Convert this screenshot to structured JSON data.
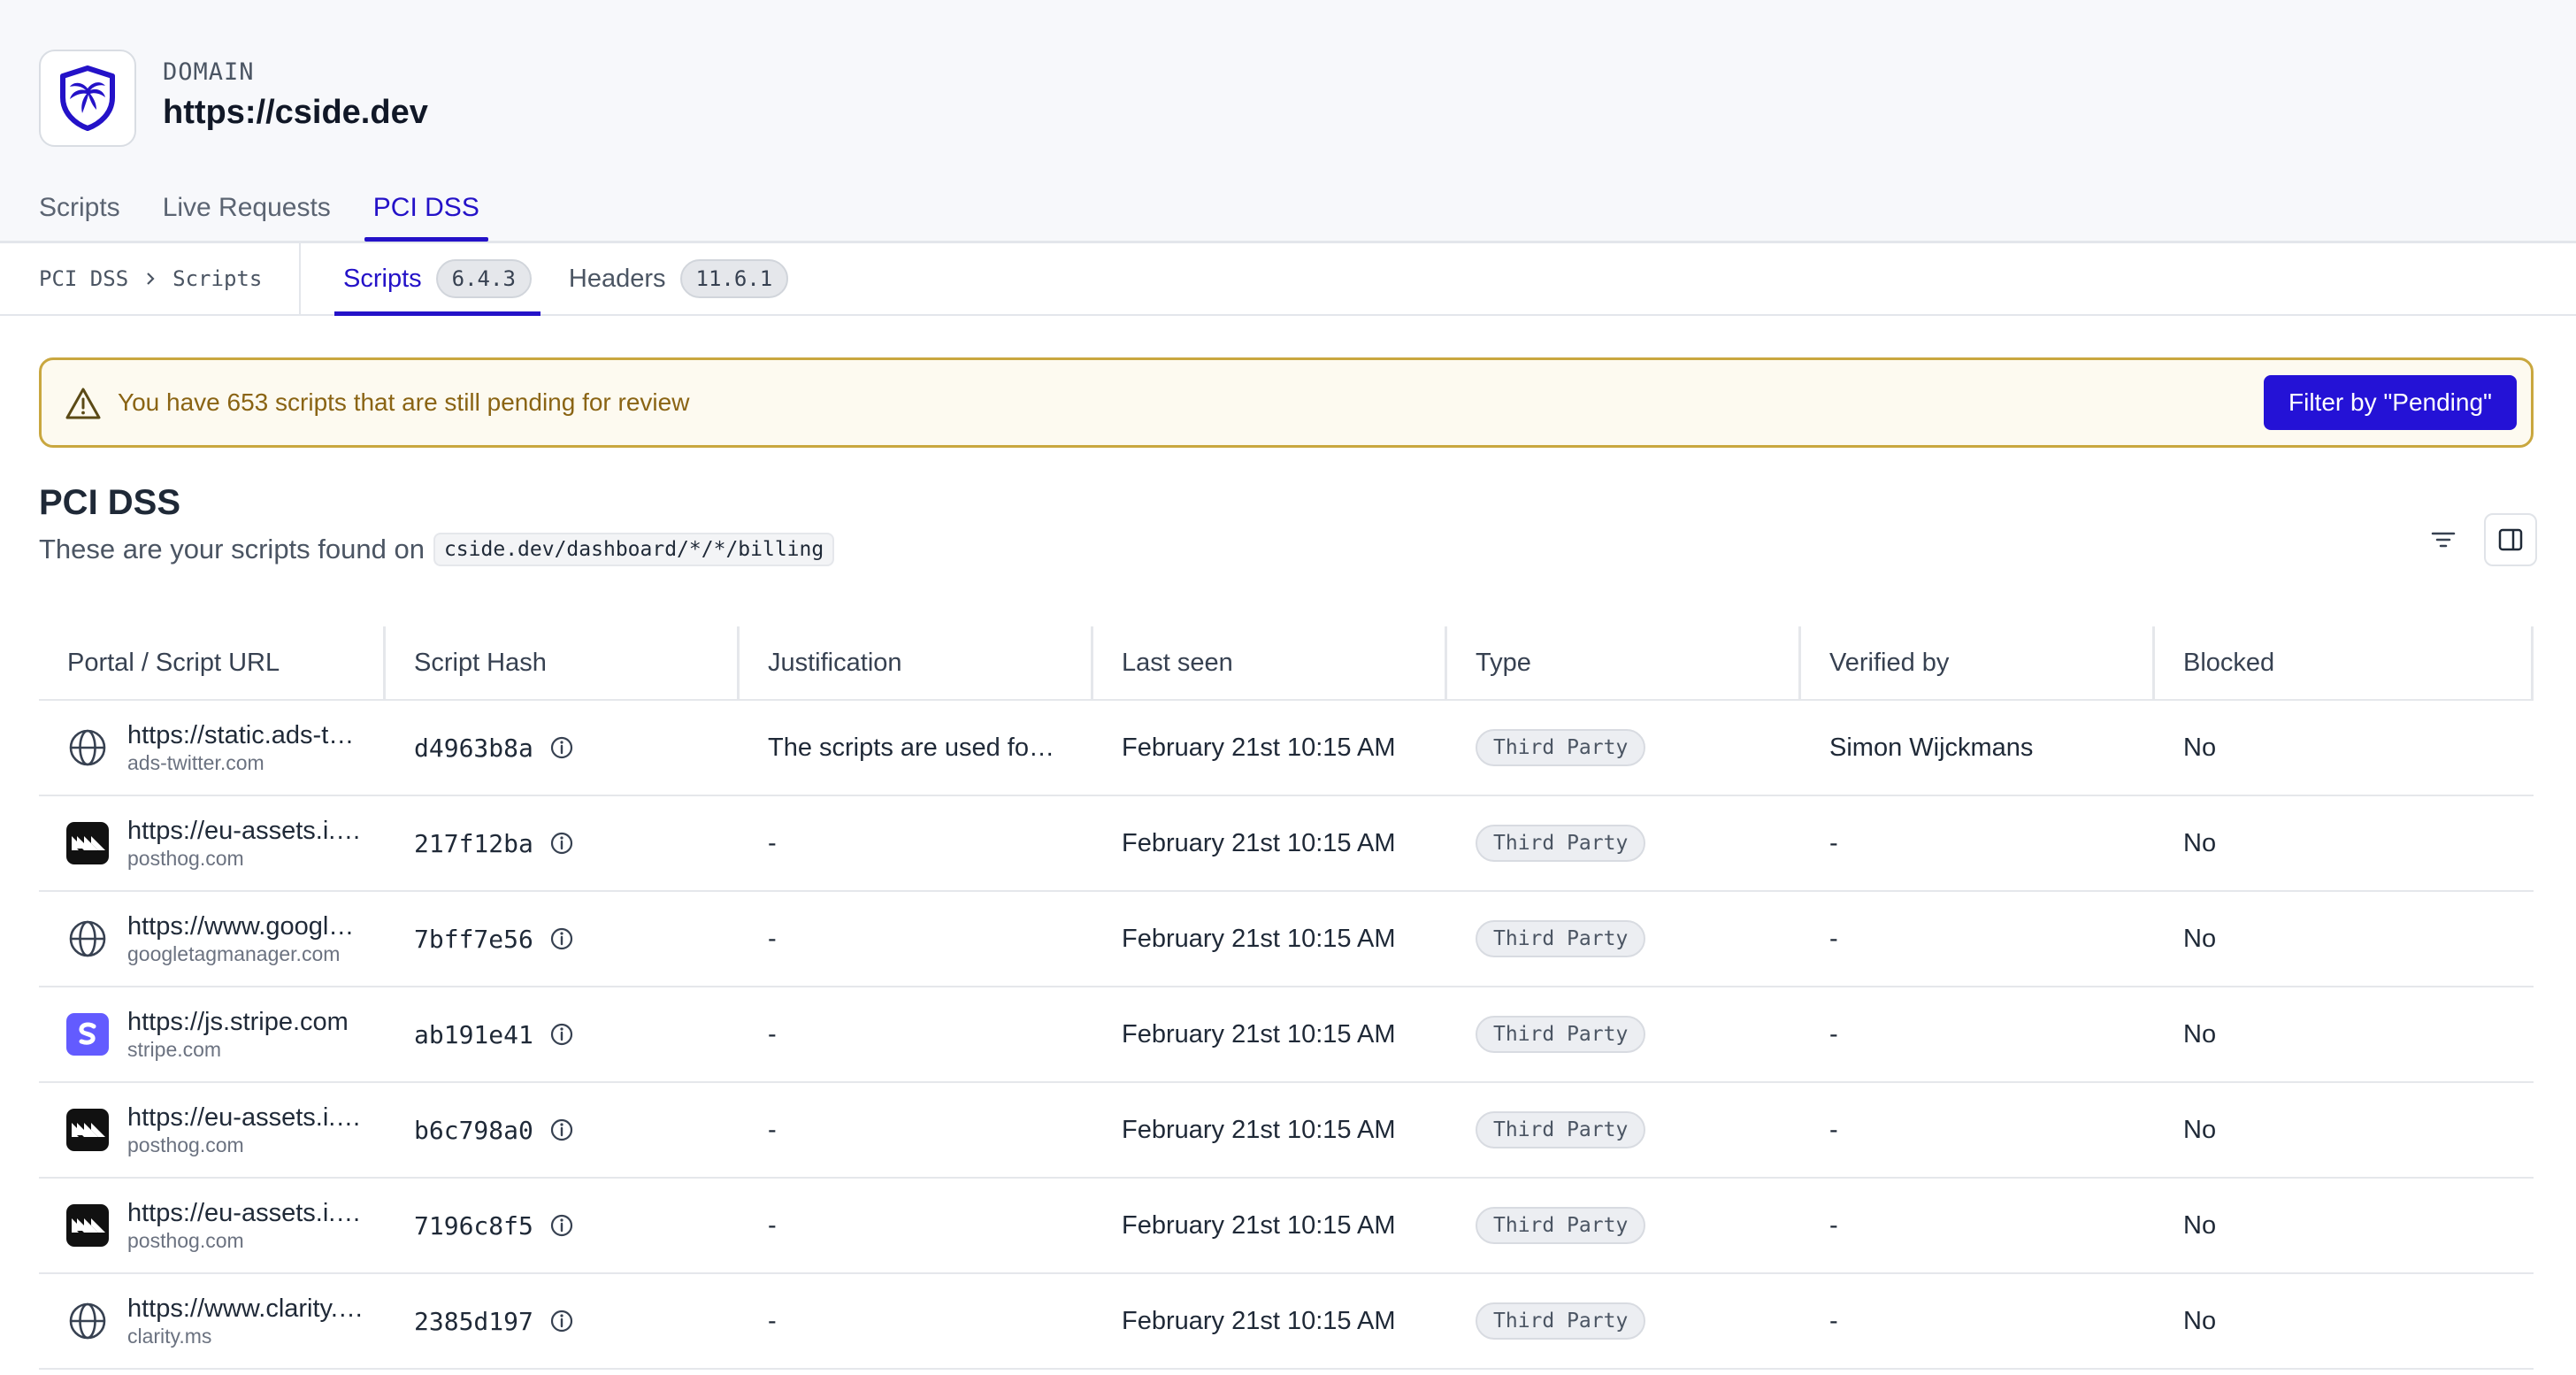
{
  "header": {
    "domain_label": "DOMAIN",
    "domain_value": "https://cside.dev",
    "tabs": [
      {
        "label": "Scripts",
        "active": false
      },
      {
        "label": "Live Requests",
        "active": false
      },
      {
        "label": "PCI DSS",
        "active": true
      }
    ]
  },
  "subnav": {
    "breadcrumb": [
      "PCI DSS",
      "Scripts"
    ],
    "tabs": [
      {
        "label": "Scripts",
        "badge": "6.4.3",
        "active": true
      },
      {
        "label": "Headers",
        "badge": "11.6.1",
        "active": false
      }
    ]
  },
  "alert": {
    "message": "You have 653 scripts that are still pending for review",
    "button_label": "Filter by \"Pending\""
  },
  "section": {
    "title": "PCI DSS",
    "subtitle": "These are your scripts found on",
    "path": "cside.dev/dashboard/*/*/billing"
  },
  "table": {
    "columns": [
      "Portal / Script URL",
      "Script Hash",
      "Justification",
      "Last seen",
      "Type",
      "Verified by",
      "Blocked"
    ],
    "rows": [
      {
        "icon": "globe-icon",
        "url": "https://static.ads-twitter.com",
        "domain": "ads-twitter.com",
        "hash": "d4963b8a",
        "justification": "The scripts are used for tracking",
        "last_seen": "February 21st 10:15 AM",
        "type": "Third Party",
        "verified_by": "Simon Wijckmans",
        "blocked": "No"
      },
      {
        "icon": "posthog-logo-icon",
        "url": "https://eu-assets.i.posthog.com",
        "domain": "posthog.com",
        "hash": "217f12ba",
        "justification": "-",
        "last_seen": "February 21st 10:15 AM",
        "type": "Third Party",
        "verified_by": "-",
        "blocked": "No"
      },
      {
        "icon": "globe-icon",
        "url": "https://www.googletagmanager.com",
        "domain": "googletagmanager.com",
        "hash": "7bff7e56",
        "justification": "-",
        "last_seen": "February 21st 10:15 AM",
        "type": "Third Party",
        "verified_by": "-",
        "blocked": "No"
      },
      {
        "icon": "stripe-logo-icon",
        "url": "https://js.stripe.com",
        "domain": "stripe.com",
        "hash": "ab191e41",
        "justification": "-",
        "last_seen": "February 21st 10:15 AM",
        "type": "Third Party",
        "verified_by": "-",
        "blocked": "No"
      },
      {
        "icon": "posthog-logo-icon",
        "url": "https://eu-assets.i.posthog.com",
        "domain": "posthog.com",
        "hash": "b6c798a0",
        "justification": "-",
        "last_seen": "February 21st 10:15 AM",
        "type": "Third Party",
        "verified_by": "-",
        "blocked": "No"
      },
      {
        "icon": "posthog-logo-icon",
        "url": "https://eu-assets.i.posthog.com",
        "domain": "posthog.com",
        "hash": "7196c8f5",
        "justification": "-",
        "last_seen": "February 21st 10:15 AM",
        "type": "Third Party",
        "verified_by": "-",
        "blocked": "No"
      },
      {
        "icon": "globe-icon",
        "url": "https://www.clarity.ms",
        "domain": "clarity.ms",
        "hash": "2385d197",
        "justification": "-",
        "last_seen": "February 21st 10:15 AM",
        "type": "Third Party",
        "verified_by": "-",
        "blocked": "No"
      }
    ]
  },
  "colors": {
    "accent": "#2412c8",
    "alert_border": "#c9a73f",
    "alert_text": "#8a6414",
    "stripe": "#635bff"
  }
}
